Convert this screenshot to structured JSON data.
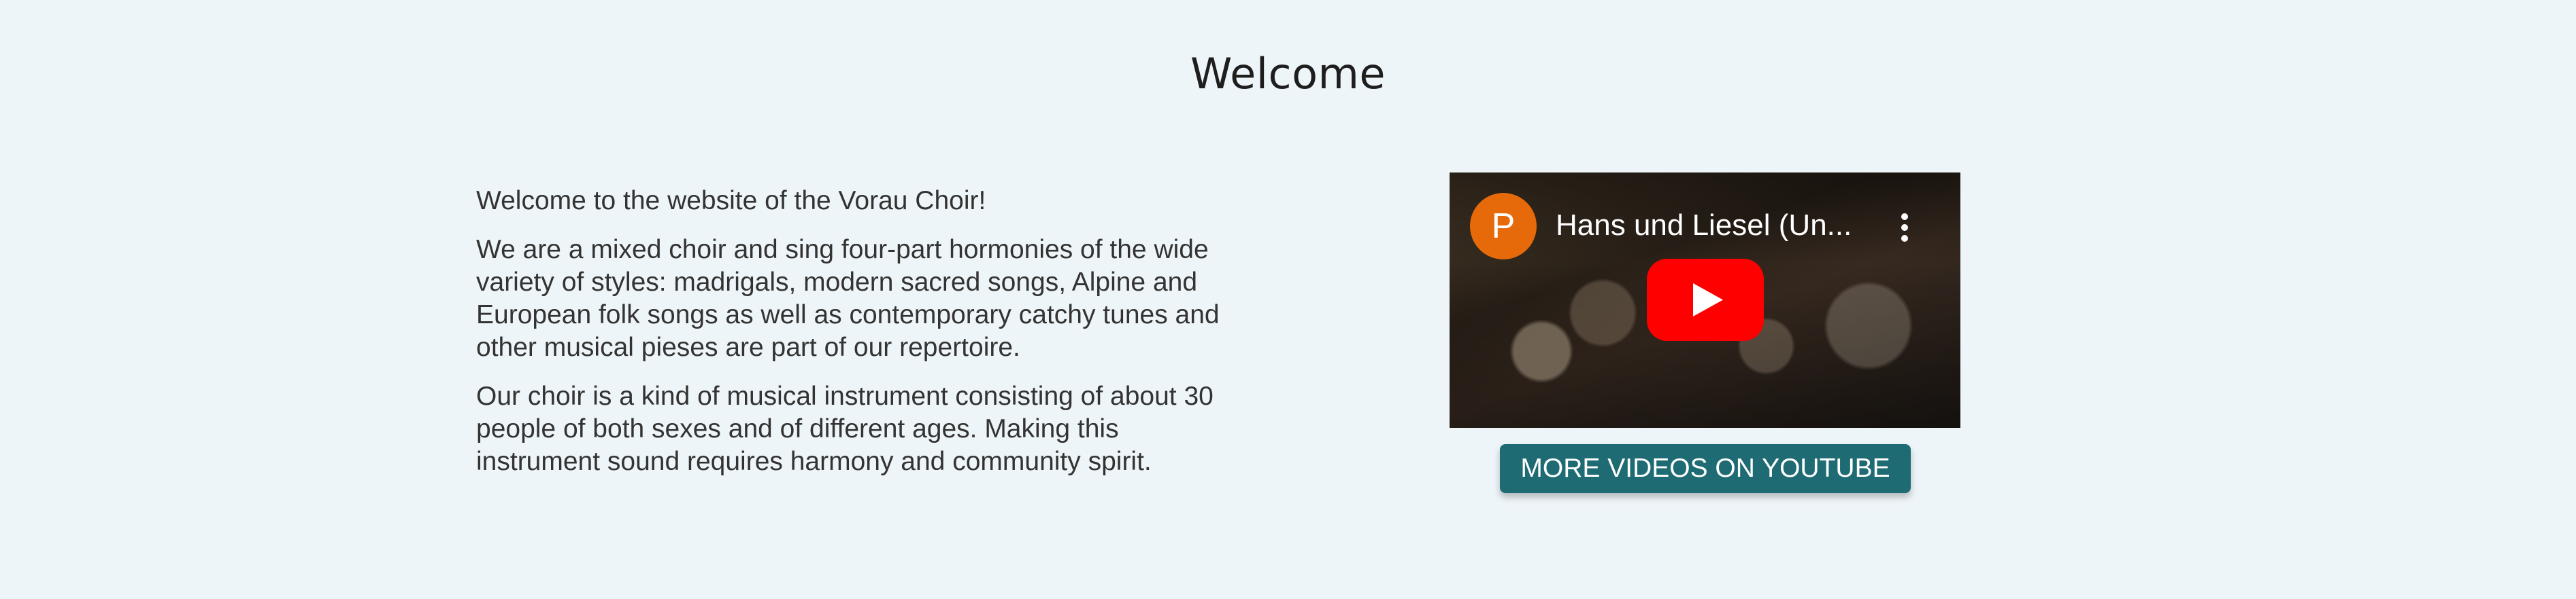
{
  "page": {
    "title": "Welcome"
  },
  "intro": {
    "paragraphs": [
      "Welcome to the website of the Vorau Choir!",
      "We are a mixed choir and sing four-part hormonies of the wide variety of styles: madrigals, modern sacred songs, Alpine and European folk songs as well as contemporary catchy tunes and other musical pieses are part of our repertoire.",
      "Our choir is a kind of musical instrument consisting of about 30 people of both sexes and of different ages. Making this instrument sound requires harmony and community spirit."
    ]
  },
  "video": {
    "channel_initial": "P",
    "title": "Hans und Liesel (Un...",
    "avatar_color": "#e66a0a",
    "play_color": "#ff0000"
  },
  "cta": {
    "label": "MORE VIDEOS ON YOUTUBE",
    "color": "#1f6b73"
  },
  "icons": {
    "play": "youtube-play-icon",
    "menu": "more-vert-icon"
  }
}
